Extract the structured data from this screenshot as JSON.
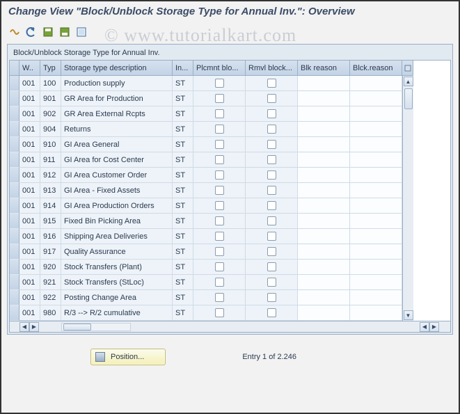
{
  "title": "Change View \"Block/Unblock Storage Type for Annual Inv.\": Overview",
  "watermark": "© www.tutorialkart.com",
  "panel_title": "Block/Unblock Storage Type for Annual Inv.",
  "columns": {
    "w": "W..",
    "typ": "Typ",
    "desc": "Storage type description",
    "in": "In...",
    "plcmnt": "Plcmnt blo...",
    "rmvl": "Rmvl block...",
    "blk": "Blk reason",
    "blck": "Blck.reason"
  },
  "rows": [
    {
      "w": "001",
      "typ": "100",
      "desc": "Production supply",
      "in": "ST"
    },
    {
      "w": "001",
      "typ": "901",
      "desc": "GR Area for Production",
      "in": "ST"
    },
    {
      "w": "001",
      "typ": "902",
      "desc": "GR Area External Rcpts",
      "in": "ST"
    },
    {
      "w": "001",
      "typ": "904",
      "desc": "Returns",
      "in": "ST"
    },
    {
      "w": "001",
      "typ": "910",
      "desc": "GI Area General",
      "in": "ST"
    },
    {
      "w": "001",
      "typ": "911",
      "desc": "GI Area for Cost Center",
      "in": "ST"
    },
    {
      "w": "001",
      "typ": "912",
      "desc": "GI Area Customer Order",
      "in": "ST"
    },
    {
      "w": "001",
      "typ": "913",
      "desc": "GI Area - Fixed Assets",
      "in": "ST"
    },
    {
      "w": "001",
      "typ": "914",
      "desc": "GI Area Production Orders",
      "in": "ST"
    },
    {
      "w": "001",
      "typ": "915",
      "desc": "Fixed Bin Picking Area",
      "in": "ST"
    },
    {
      "w": "001",
      "typ": "916",
      "desc": "Shipping Area Deliveries",
      "in": "ST"
    },
    {
      "w": "001",
      "typ": "917",
      "desc": "Quality Assurance",
      "in": "ST"
    },
    {
      "w": "001",
      "typ": "920",
      "desc": "Stock Transfers (Plant)",
      "in": "ST"
    },
    {
      "w": "001",
      "typ": "921",
      "desc": "Stock Transfers (StLoc)",
      "in": "ST"
    },
    {
      "w": "001",
      "typ": "922",
      "desc": "Posting Change Area",
      "in": "ST"
    },
    {
      "w": "001",
      "typ": "980",
      "desc": "R/3 --> R/2 cumulative",
      "in": "ST"
    }
  ],
  "position_button": "Position...",
  "entry_text": "Entry 1 of 2.246",
  "toolbar_icons": [
    "other-view",
    "undo",
    "save",
    "select-all",
    "deselect-all"
  ]
}
